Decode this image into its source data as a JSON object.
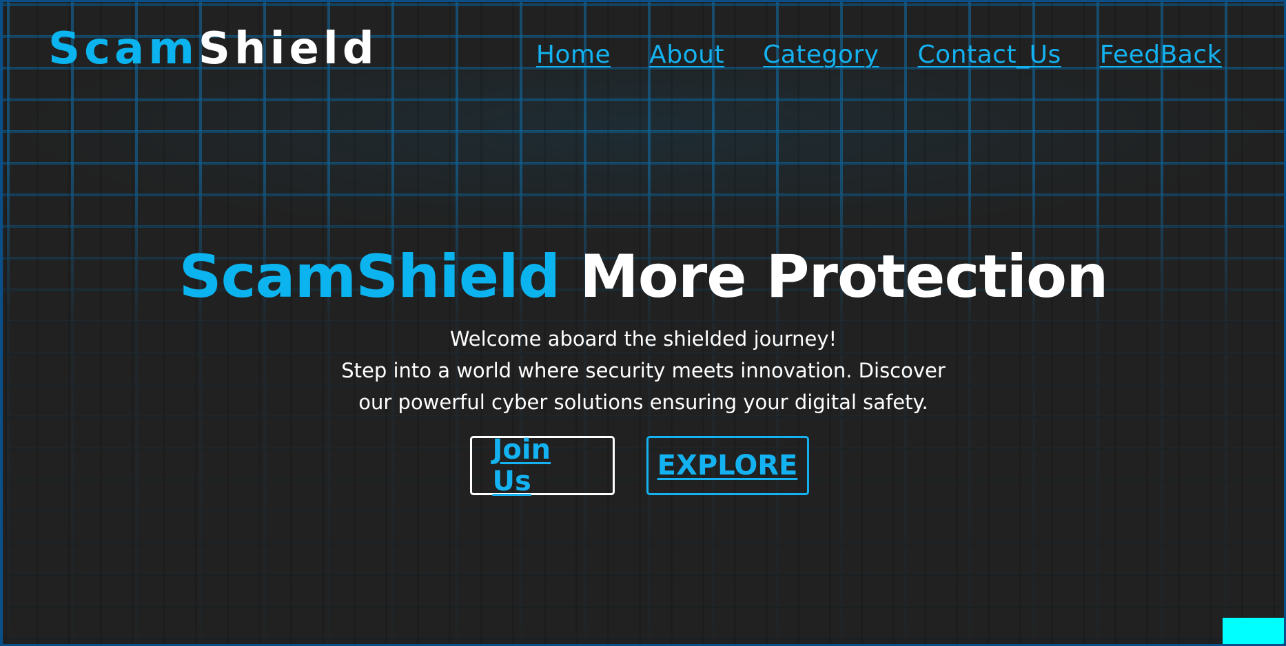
{
  "brand": {
    "part1": "Scam",
    "part2": "Shield"
  },
  "nav": {
    "items": [
      "Home",
      "About",
      "Category",
      "Contact_Us",
      "FeedBack"
    ]
  },
  "hero": {
    "title_highlight": "ScamShield",
    "title_rest": "More Protection",
    "line1": "Welcome aboard the shielded journey!",
    "line2": "Step into a world where security meets innovation. Discover",
    "line3": "our powerful cyber solutions ensuring your digital safety."
  },
  "buttons": {
    "join": "Join Us",
    "explore": "EXPLORE"
  },
  "colors": {
    "accent": "#0bb4ef",
    "background": "#212121",
    "frame": "#0a4f87",
    "corner_box": "#00ffff"
  }
}
